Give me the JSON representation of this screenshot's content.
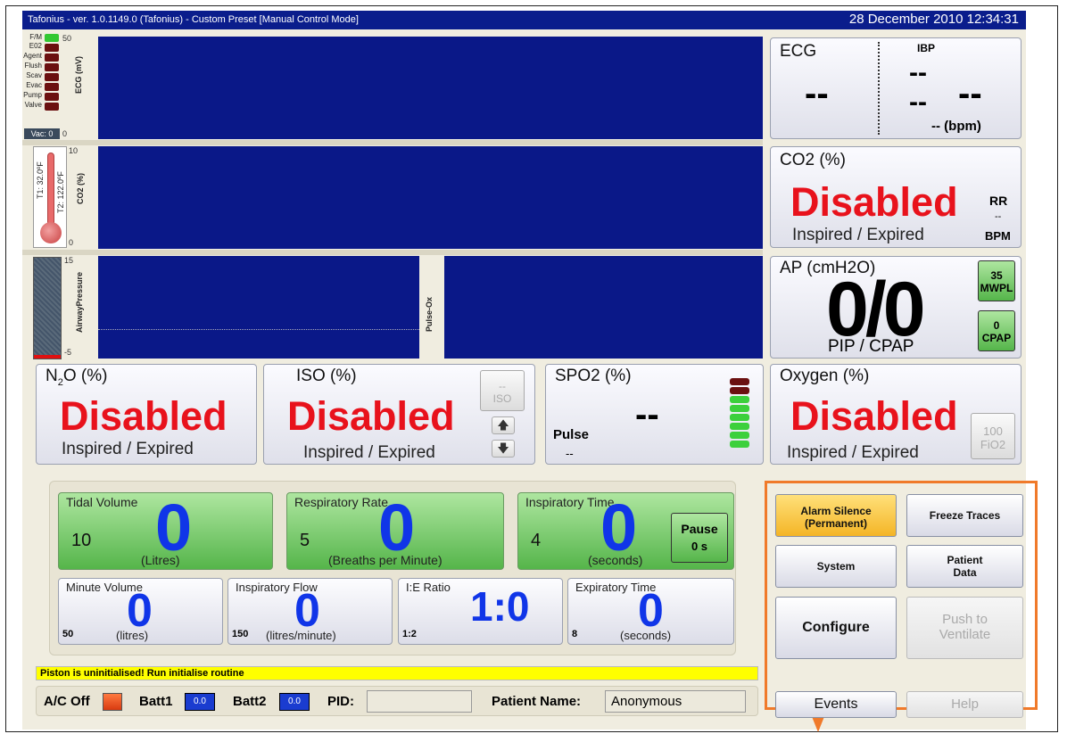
{
  "window": {
    "title": "Tafonius - ver. 1.0.1149.0 (Tafonius) - Custom Preset [Manual Control Mode]",
    "datetime": "28 December 2010 12:34:31"
  },
  "indicators": {
    "labels": [
      "F/M",
      "E02",
      "Agent",
      "Flush",
      "Scav",
      "Evac",
      "Pump",
      "Valve"
    ],
    "vac_label": "Vac: 0"
  },
  "temps": {
    "t1": "T1: 32.0ºF",
    "t2": "T2: 122.0ºF"
  },
  "traces": {
    "ecg": {
      "label": "ECG (mV)",
      "max": "50",
      "min": "0"
    },
    "co2": {
      "label": "CO2 (%)",
      "max": "10",
      "min": "0"
    },
    "airway": {
      "label": "AirwayPressure",
      "max": "15",
      "min": "-5"
    },
    "pulseox_label": "Pulse-Ox"
  },
  "ecg_panel": {
    "title": "ECG",
    "ibp_label": "IBP",
    "ecg_value": "--",
    "ibp_top": "--",
    "ibp_bottom": "--",
    "ibp_big": "--",
    "bpm": "--  (bpm)"
  },
  "co2_panel": {
    "title": "CO2 (%)",
    "value": "Disabled",
    "sub": "Inspired / Expired",
    "rr_label": "RR",
    "rr_value": "--",
    "rr_units": "BPM"
  },
  "ap_panel": {
    "title": "AP (cmH2O)",
    "value": "0/0",
    "sub": "PIP / CPAP",
    "mwpl_value": "35",
    "mwpl_label": "MWPL",
    "cpap_value": "0",
    "cpap_label": "CPAP"
  },
  "n2o_panel": {
    "title_main": "N",
    "title_sub": "2",
    "title_rest": "O (%)",
    "value": "Disabled",
    "sub": "Inspired / Expired"
  },
  "iso_panel": {
    "title": "ISO (%)",
    "value": "Disabled",
    "sub": "Inspired / Expired",
    "btn_value": "--",
    "btn_label": "ISO",
    "up": "🡅",
    "down": "🡇"
  },
  "spo2_panel": {
    "title": "SPO2 (%)",
    "value": "--",
    "pulse_label": "Pulse",
    "pulse_value": "--"
  },
  "oxygen_panel": {
    "title": "Oxygen (%)",
    "value": "Disabled",
    "sub": "Inspired / Expired",
    "fio2_value": "100",
    "fio2_label": "FiO2"
  },
  "controls": {
    "tidal": {
      "title": "Tidal Volume",
      "setting": "10",
      "value": "0",
      "units": "(Litres)"
    },
    "resp": {
      "title": "Respiratory Rate",
      "setting": "5",
      "value": "0",
      "units": "(Breaths per Minute)"
    },
    "insp_time": {
      "title": "Inspiratory Time",
      "setting": "4",
      "value": "0",
      "units": "(seconds)",
      "pause_label": "Pause",
      "pause_value": "0 s"
    },
    "minute_vol": {
      "title": "Minute Volume",
      "setting": "50",
      "value": "0",
      "units": "(litres)"
    },
    "insp_flow": {
      "title": "Inspiratory Flow",
      "setting": "150",
      "value": "0",
      "units": "(litres/minute)"
    },
    "ie_ratio": {
      "title": "I:E Ratio",
      "setting": "1:2",
      "value": "1:0"
    },
    "exp_time": {
      "title": "Expiratory Time",
      "setting": "8",
      "value": "0",
      "units": "(seconds)"
    }
  },
  "buttons": {
    "alarm_silence": "Alarm Silence\n(Permanent)",
    "alarm_line1": "Alarm Silence",
    "alarm_line2": "(Permanent)",
    "freeze": "Freeze Traces",
    "system": "System",
    "patient_line1": "Patient",
    "patient_line2": "Data",
    "configure": "Configure",
    "push_line1": "Push to",
    "push_line2": "Ventilate",
    "events": "Events",
    "help": "Help"
  },
  "status": {
    "message": "Piston is uninitialised! Run initialise routine",
    "ac_label": "A/C Off",
    "batt1_label": "Batt1",
    "batt1_value": "0.0",
    "batt2_label": "Batt2",
    "batt2_value": "0.0",
    "pid_label": "PID:",
    "pid_value": "",
    "patient_name_label": "Patient Name:",
    "patient_name_value": "Anonymous"
  },
  "colors": {
    "trace_bg": "#0a1888",
    "title_bg": "#0a1d8c",
    "alarm_red": "#e8121c",
    "value_blue": "#1035e8",
    "accent_orange": "#f07a2a"
  }
}
